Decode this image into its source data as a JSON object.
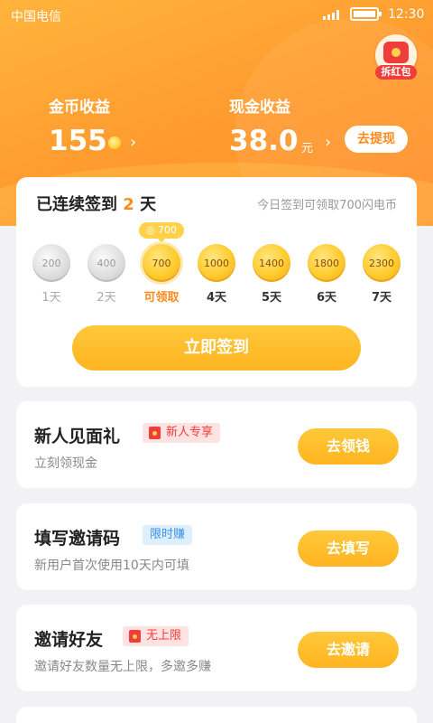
{
  "status_bar": {
    "carrier": "中国电信",
    "time": "12:30"
  },
  "red_packet": {
    "label": "拆红包",
    "icon": "red-envelope-icon"
  },
  "earnings": {
    "coins": {
      "label": "金币收益",
      "value": "155"
    },
    "cash": {
      "label": "现金收益",
      "value": "38.0",
      "unit": "元",
      "withdraw_label": "去提现"
    }
  },
  "signin": {
    "title_prefix": "已连续签到",
    "streak_days": "2",
    "title_suffix": "天",
    "hint": "今日签到可领取700闪电币",
    "today_reward_badge": "700",
    "days": [
      {
        "coins": "200",
        "label": "1天",
        "state": "claimed"
      },
      {
        "coins": "400",
        "label": "2天",
        "state": "claimed"
      },
      {
        "coins": "700",
        "label": "可领取",
        "state": "today"
      },
      {
        "coins": "1000",
        "label": "4天",
        "state": "future"
      },
      {
        "coins": "1400",
        "label": "5天",
        "state": "future"
      },
      {
        "coins": "1800",
        "label": "6天",
        "state": "future"
      },
      {
        "coins": "2300",
        "label": "7天",
        "state": "future"
      }
    ],
    "button_label": "立即签到"
  },
  "tasks": [
    {
      "title": "新人见面礼",
      "tag": "新人专享",
      "tag_style": "red",
      "desc": "立刻领现金",
      "button": "去领钱"
    },
    {
      "title": "填写邀请码",
      "tag": "限时赚",
      "tag_style": "blue",
      "desc": "新用户首次使用10天内可填",
      "button": "去填写"
    },
    {
      "title": "邀请好友",
      "tag": "无上限",
      "tag_style": "red",
      "desc": "邀请好友数量无上限，多邀多赚",
      "button": "去邀请"
    }
  ],
  "colors": {
    "accent": "#ff9a2e",
    "button": "#ffb420",
    "tag_red": "#ef3d3b",
    "tag_blue": "#3a8ee6"
  }
}
